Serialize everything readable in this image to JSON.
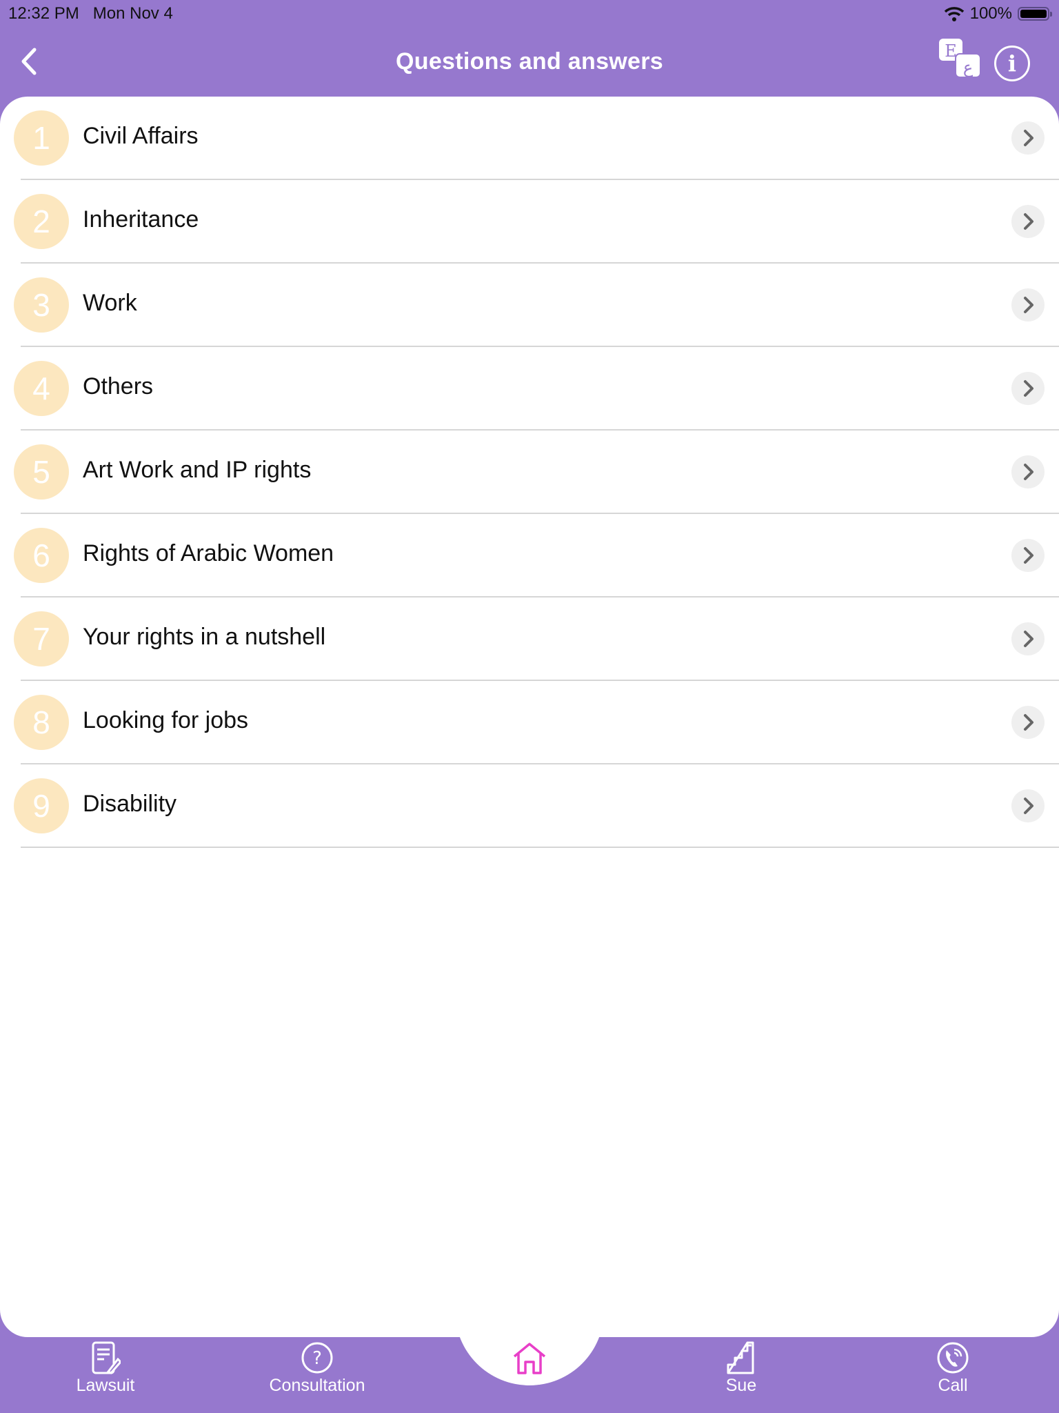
{
  "status_bar": {
    "time": "12:32 PM",
    "date": "Mon Nov 4",
    "battery": "100%",
    "battery_level": 1.0,
    "wifi": "wifi-icon"
  },
  "header": {
    "title": "Questions and answers",
    "back_icon": "chevron-left-icon",
    "language_icon": "language-switch-icon",
    "language_letters": [
      "E",
      "ع"
    ],
    "info_icon": "info-icon"
  },
  "colors": {
    "primary": "#9678ce",
    "number_circle": "#fce7bf",
    "home_active": "#e83fc8",
    "chevron_bg": "#efefef"
  },
  "categories": [
    {
      "number": "1",
      "label": "Civil Affairs"
    },
    {
      "number": "2",
      "label": "Inheritance"
    },
    {
      "number": "3",
      "label": "Work"
    },
    {
      "number": "4",
      "label": "Others"
    },
    {
      "number": "5",
      "label": "Art Work and IP rights"
    },
    {
      "number": "6",
      "label": "Rights of Arabic Women"
    },
    {
      "number": "7",
      "label": "Your rights in a nutshell"
    },
    {
      "number": "8",
      "label": "Looking for jobs"
    },
    {
      "number": "9",
      "label": "Disability"
    }
  ],
  "tabs": [
    {
      "label": "Lawsuit",
      "icon": "document-edit-icon"
    },
    {
      "label": "Consultation",
      "icon": "question-circle-icon"
    },
    {
      "label": "",
      "icon": "home-icon",
      "active": true
    },
    {
      "label": "Sue",
      "icon": "stairs-icon"
    },
    {
      "label": "Call",
      "icon": "phone-icon"
    }
  ]
}
